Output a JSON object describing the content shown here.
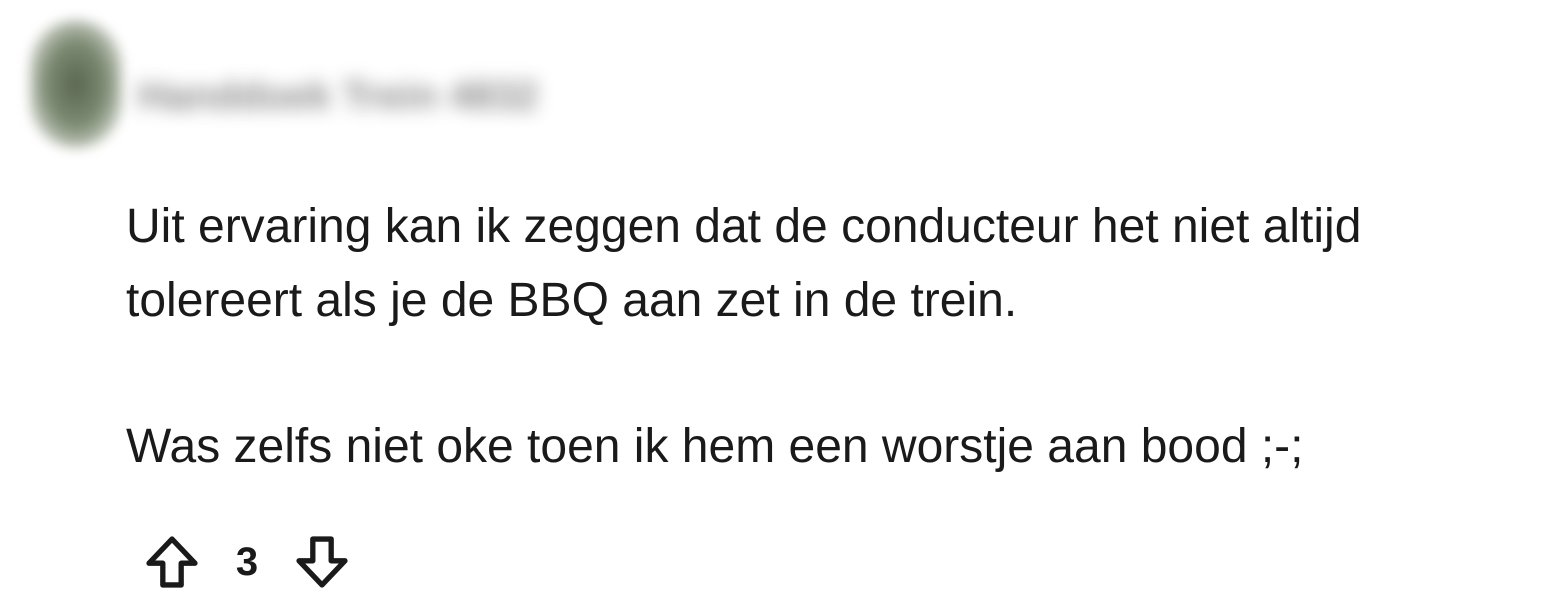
{
  "comment": {
    "author": "Handdoek Trein 4832",
    "body_paragraphs": [
      "Uit ervaring kan ik zeggen dat de conducteur het niet altijd tolereert als je de BBQ aan zet in de trein.",
      "Was zelfs niet oke toen ik hem een worstje aan bood ;-;"
    ],
    "score": "3"
  },
  "icons": {
    "upvote": "arrow-up-outline-icon",
    "downvote": "arrow-down-outline-icon"
  },
  "colors": {
    "text": "#1a1a1b",
    "background": "#ffffff",
    "avatar": "#6b7a62"
  }
}
